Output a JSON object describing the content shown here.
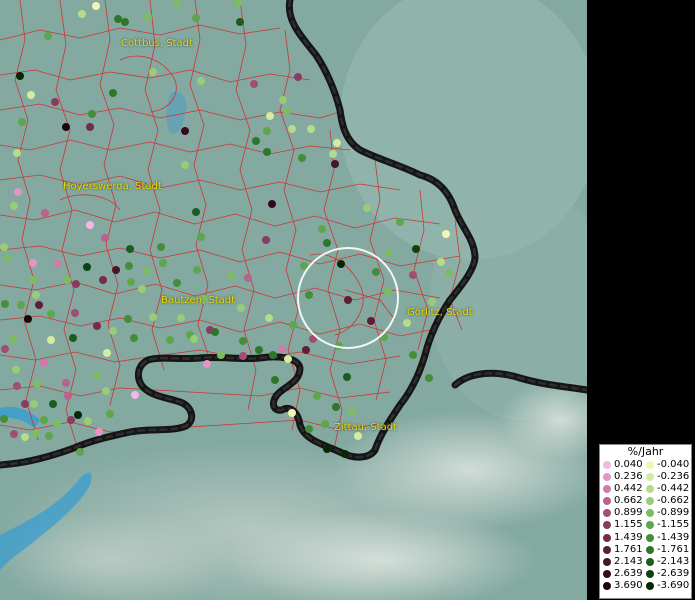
{
  "cities": [
    {
      "name": "Cottbus, Stadt"
    },
    {
      "name": "Hoyerswerda, Stadt"
    },
    {
      "name": "Bautzen, Stadt"
    },
    {
      "name": "Görlitz, Stadt"
    },
    {
      "name": "Zittau, Stadt"
    }
  ],
  "legend": {
    "title": "%/Jahr",
    "positive": [
      {
        "value": "0.040",
        "color": "#f4b6e6"
      },
      {
        "value": "0.236",
        "color": "#e296c4"
      },
      {
        "value": "0.442",
        "color": "#d07aa8"
      },
      {
        "value": "0.662",
        "color": "#b8628e"
      },
      {
        "value": "0.899",
        "color": "#a04e74"
      },
      {
        "value": "1.155",
        "color": "#8a3c5e"
      },
      {
        "value": "1.439",
        "color": "#742c4a"
      },
      {
        "value": "1.761",
        "color": "#5e1e38"
      },
      {
        "value": "2.143",
        "color": "#481428"
      },
      {
        "value": "2.639",
        "color": "#320a1a"
      },
      {
        "value": "3.690",
        "color": "#1c030c"
      }
    ],
    "negative": [
      {
        "value": "-0.040",
        "color": "#eef8b4"
      },
      {
        "value": "-0.236",
        "color": "#d2eca0"
      },
      {
        "value": "-0.442",
        "color": "#b4dc8a"
      },
      {
        "value": "-0.662",
        "color": "#98cc76"
      },
      {
        "value": "-0.899",
        "color": "#7cbc62"
      },
      {
        "value": "-1.155",
        "color": "#5ea64c"
      },
      {
        "value": "-1.439",
        "color": "#448e3a"
      },
      {
        "value": "-1.761",
        "color": "#2e762c"
      },
      {
        "value": "-2.143",
        "color": "#1c5c1e"
      },
      {
        "value": "-2.639",
        "color": "#0e4212"
      },
      {
        "value": "-3.690",
        "color": "#042806"
      }
    ]
  },
  "colors": {
    "background": "#7fa8a2",
    "district_lines": "#d42a2a",
    "border": "#151515",
    "city_label": "#e8d800",
    "water": "#3a9ed0",
    "selection_ring": "#ffffff"
  }
}
